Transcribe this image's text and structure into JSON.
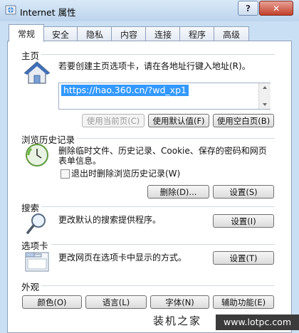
{
  "window": {
    "title": "Internet 属性",
    "help": "?",
    "close": "✕"
  },
  "tabs": [
    "常规",
    "安全",
    "隐私",
    "内容",
    "连接",
    "程序",
    "高级"
  ],
  "homepage": {
    "heading": "主页",
    "description": "若要创建主页选项卡，请在各地址行键入地址(R)。",
    "url": "https://hao.360.cn/?wd_xp1",
    "buttons": [
      "使用当前页(C)",
      "使用默认值(F)",
      "使用空白页(B)"
    ]
  },
  "history": {
    "heading": "浏览历史记录",
    "description_line1": "删除临时文件、历史记录、Cookie、保存的密码和网页",
    "description_line2": "表单信息。",
    "checkbox_label": "退出时删除浏览历史记录(W)",
    "buttons": [
      "删除(D)...",
      "设置(S)"
    ]
  },
  "search": {
    "heading": "搜索",
    "description": "更改默认的搜索提供程序。",
    "button": "设置(I)"
  },
  "tabs_section": {
    "heading": "选项卡",
    "description": "更改网页在选项卡中显示的方式。",
    "button": "设置(T)"
  },
  "appearance": {
    "heading": "外观",
    "buttons": [
      "颜色(O)",
      "语言(L)",
      "字体(N)",
      "辅助功能(E)"
    ]
  },
  "watermark": {
    "text": "装机之家",
    "url": "www.lotpc.com"
  }
}
